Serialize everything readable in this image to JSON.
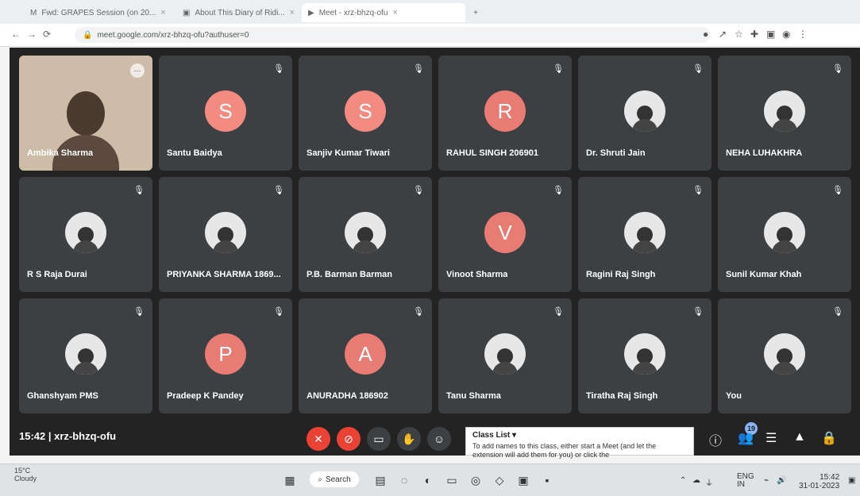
{
  "browser": {
    "tabs": [
      {
        "label": "Fwd: GRAPES Session (on 20..."
      },
      {
        "label": "About This Diary of Ridi..."
      },
      {
        "label": "Meet - xrz-bhzq-ofu"
      }
    ],
    "url": "meet.google.com/xrz-bhzq-ofu?authuser=0"
  },
  "meet": {
    "meeting_time": "15:42",
    "meeting_code": "xrz-bhzq-ofu",
    "participants_count": "19",
    "tiles": [
      {
        "name": "Ambika Sharma",
        "type": "camera"
      },
      {
        "name": "Santu Baidya",
        "type": "letter",
        "letter": "S",
        "color": "#f28b82"
      },
      {
        "name": "Sanjiv Kumar Tiwari",
        "type": "letter",
        "letter": "S",
        "color": "#f28b82"
      },
      {
        "name": "RAHUL SINGH 206901",
        "type": "letter",
        "letter": "R",
        "color": "#e87b73"
      },
      {
        "name": "Dr. Shruti Jain",
        "type": "photo"
      },
      {
        "name": "NEHA LUHAKHRA",
        "type": "photo"
      },
      {
        "name": "R S Raja Durai",
        "type": "photo"
      },
      {
        "name": "PRIYANKA SHARMA 1869...",
        "type": "photo"
      },
      {
        "name": "P.B. Barman Barman",
        "type": "photo"
      },
      {
        "name": "Vinoot Sharma",
        "type": "letter",
        "letter": "V",
        "color": "#e87b73"
      },
      {
        "name": "Ragini Raj Singh",
        "type": "photo"
      },
      {
        "name": "Sunil Kumar Khah",
        "type": "photo"
      },
      {
        "name": "Ghanshyam PMS",
        "type": "photo"
      },
      {
        "name": "Pradeep K Pandey",
        "type": "letter",
        "letter": "P",
        "color": "#e87b73"
      },
      {
        "name": "ANURADHA 186902",
        "type": "letter",
        "letter": "A",
        "color": "#e87b73"
      },
      {
        "name": "Tanu Sharma",
        "type": "photo"
      },
      {
        "name": "Tiratha Raj Singh",
        "type": "photo"
      },
      {
        "name": "You",
        "type": "photo"
      }
    ],
    "class_list": {
      "title": "Class List",
      "message": "To add names to this class, either start a Meet (and let the extension will add them for you) or click the"
    }
  },
  "taskbar": {
    "weather_temp": "15°C",
    "weather_desc": "Cloudy",
    "search": "Search",
    "lang_top": "ENG",
    "lang_bottom": "IN",
    "clock_time": "15:42",
    "clock_date": "31-01-2023"
  }
}
